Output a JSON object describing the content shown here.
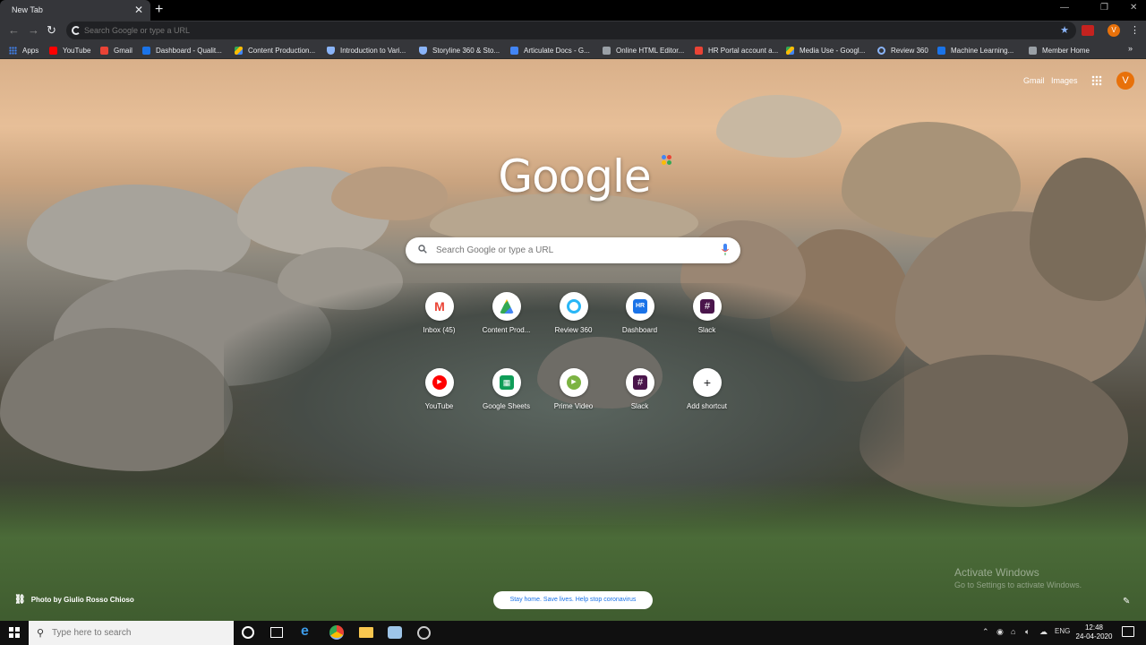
{
  "browser": {
    "tab_title": "New Tab",
    "tab_close": "✕",
    "new_tab": "+",
    "window_controls": {
      "minimize": "—",
      "maximize": "❐",
      "close": "✕"
    },
    "nav": {
      "back": "←",
      "forward": "→",
      "reload": "↻"
    },
    "omnibox_placeholder": "Search Google or type a URL",
    "profile_initial": "V",
    "menu": "⋮"
  },
  "bookmarks": {
    "items": [
      {
        "label": "Apps",
        "color": "#4285f4"
      },
      {
        "label": "YouTube",
        "color": "#ff0000"
      },
      {
        "label": "Gmail",
        "color": "#ea4335"
      },
      {
        "label": "Dashboard - Qualit...",
        "color": "#1a73e8"
      },
      {
        "label": "Content Production...",
        "color": "#fbbc04"
      },
      {
        "label": "Introduction to Vari...",
        "color": "#8ab4f8"
      },
      {
        "label": "Storyline 360 & Sto...",
        "color": "#8ab4f8"
      },
      {
        "label": "Articulate Docs - G...",
        "color": "#4285f4"
      },
      {
        "label": "Online HTML Editor...",
        "color": "#9aa0a6"
      },
      {
        "label": "HR Portal account a...",
        "color": "#ea4335"
      },
      {
        "label": "Media Use - Googl...",
        "color": "#fbbc04"
      },
      {
        "label": "Review 360",
        "color": "#1a73e8"
      },
      {
        "label": "Machine Learning...",
        "color": "#1a73e8"
      },
      {
        "label": "Member Home",
        "color": "#9aa0a6"
      }
    ],
    "more": "»"
  },
  "newtab": {
    "top_links": {
      "gmail": "Gmail",
      "images": "Images"
    },
    "avatar_initial": "V",
    "logo": "Google",
    "search_placeholder": "Search Google or type a URL",
    "shortcuts": [
      {
        "label": "Inbox (45)",
        "icon": "gmail-icon",
        "color": "#ea4335"
      },
      {
        "label": "Content Prod...",
        "icon": "drive-icon",
        "color": "#34a853"
      },
      {
        "label": "Review 360",
        "icon": "review-icon",
        "color": "#29b6f6"
      },
      {
        "label": "Dashboard",
        "icon": "hr-icon",
        "color": "#1a73e8"
      },
      {
        "label": "Slack",
        "icon": "slack-icon",
        "color": "#4a154b"
      },
      {
        "label": "YouTube",
        "icon": "youtube-icon",
        "color": "#ff0000"
      },
      {
        "label": "Google Sheets",
        "icon": "sheets-icon",
        "color": "#0f9d58"
      },
      {
        "label": "Prime Video",
        "icon": "prime-video-icon",
        "color": "#7cb342"
      },
      {
        "label": "Slack",
        "icon": "slack-icon",
        "color": "#4a154b"
      },
      {
        "label": "Add shortcut",
        "icon": "plus-icon",
        "color": "#202124"
      }
    ],
    "photo_credit": "Photo by Giulio Rosso Chioso",
    "promo": "Stay home. Save lives. Help stop coronavirus",
    "watermark_title": "Activate Windows",
    "watermark_sub": "Go to Settings to activate Windows."
  },
  "taskbar": {
    "search_placeholder": "Type here to search",
    "lang": "ENG",
    "time": "12:48",
    "date": "24-04-2020"
  }
}
